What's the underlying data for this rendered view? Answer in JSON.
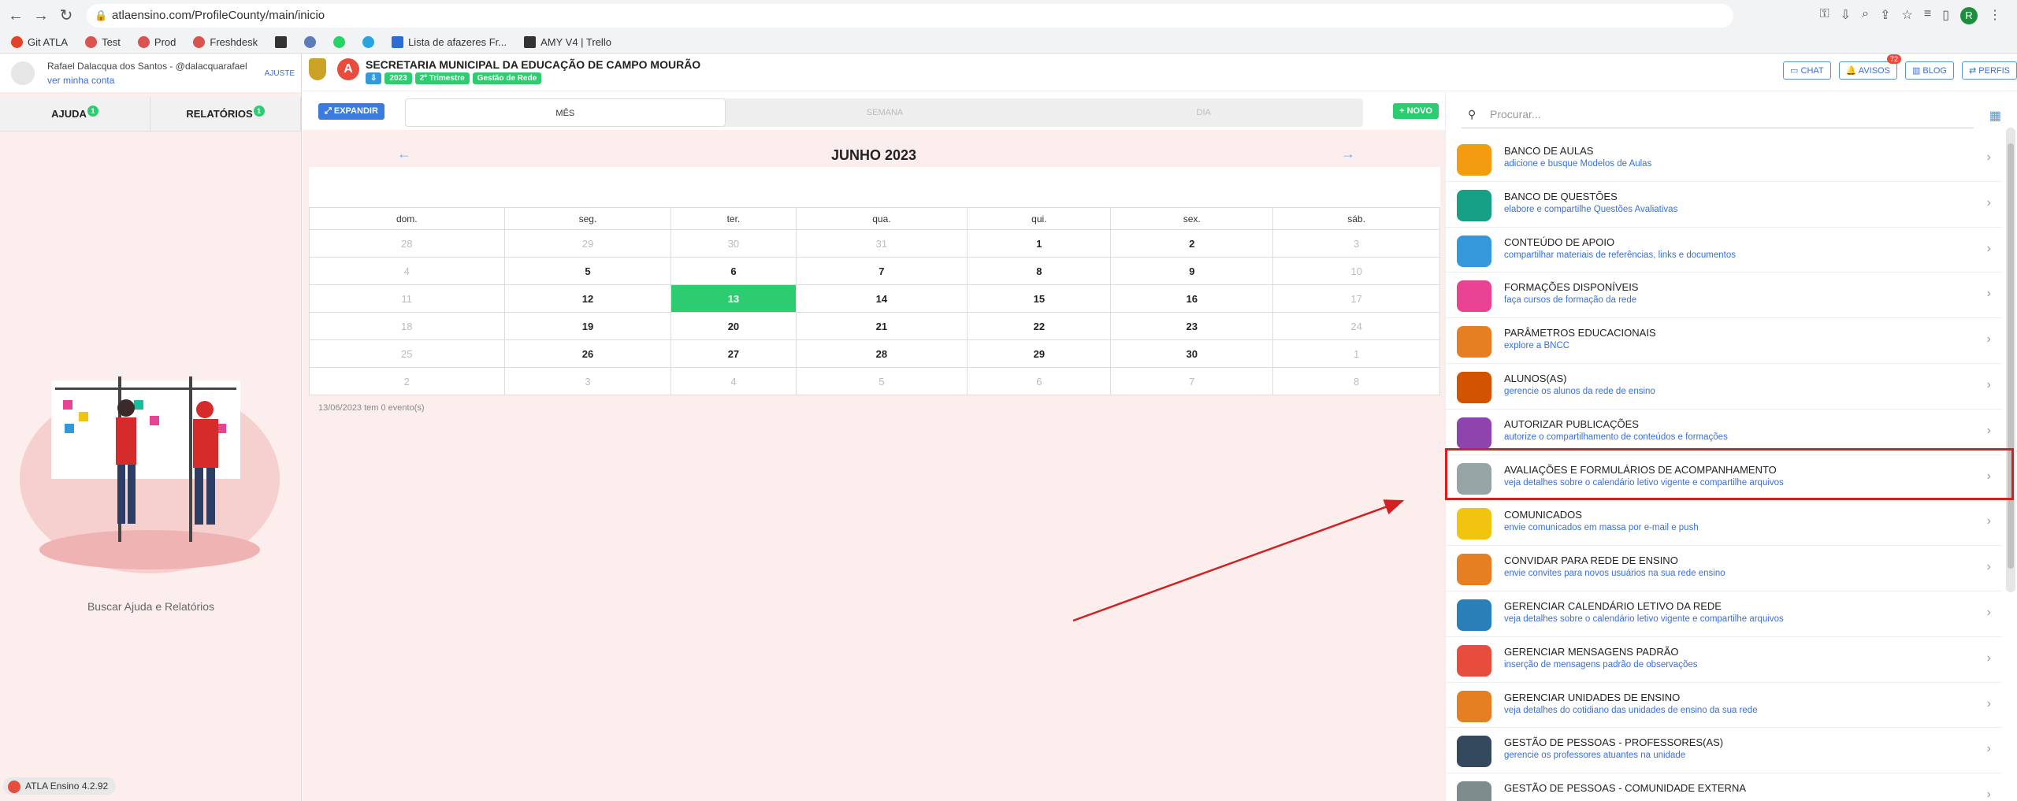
{
  "browser": {
    "url": "atlaensino.com/ProfileCounty/main/inicio",
    "bookmarks": [
      "Git ATLA",
      "Test",
      "Prod",
      "Freshdesk",
      "",
      "",
      "",
      "",
      "Lista de afazeres Fr...",
      "AMY V4 | Trello"
    ]
  },
  "sidebar": {
    "user_name": "Rafael Dalacqua dos Santos - @dalacquarafael",
    "account_link": "ver minha conta",
    "adjust": "AJUSTE",
    "tabs": [
      {
        "label": "AJUDA",
        "badge": "1"
      },
      {
        "label": "RELATÓRIOS",
        "badge": "1"
      }
    ],
    "help_text": "Buscar Ajuda e Relatórios",
    "version": "ATLA Ensino 4.2.92"
  },
  "header": {
    "title": "SECRETARIA MUNICIPAL DA EDUCAÇÃO DE CAMPO MOURÃO",
    "chips": [
      "2023",
      "2º Trimestre",
      "Gestão de Rede"
    ],
    "buttons": [
      {
        "label": "CHAT"
      },
      {
        "label": "AVISOS",
        "badge": "72"
      },
      {
        "label": "BLOG"
      },
      {
        "label": "PERFIS"
      }
    ]
  },
  "calendar": {
    "expand": "EXPANDIR",
    "views": [
      "MÊS",
      "SEMANA",
      "DIA"
    ],
    "new": "NOVO",
    "month_title": "JUNHO 2023",
    "weekdays": [
      "dom.",
      "seg.",
      "ter.",
      "qua.",
      "qui.",
      "sex.",
      "sáb."
    ],
    "weeks": [
      [
        "28",
        "29",
        "30",
        "31",
        "1",
        "2",
        "3"
      ],
      [
        "4",
        "5",
        "6",
        "7",
        "8",
        "9",
        "10"
      ],
      [
        "11",
        "12",
        "13",
        "14",
        "15",
        "16",
        "17"
      ],
      [
        "18",
        "19",
        "20",
        "21",
        "22",
        "23",
        "24"
      ],
      [
        "25",
        "26",
        "27",
        "28",
        "29",
        "30",
        "1"
      ],
      [
        "2",
        "3",
        "4",
        "5",
        "6",
        "7",
        "8"
      ]
    ],
    "events_text": "13/06/2023 tem 0 evento(s)"
  },
  "menu": {
    "search_placeholder": "Procurar...",
    "items": [
      {
        "title": "BANCO DE AULAS",
        "subtitle": "adicione e busque Modelos de Aulas",
        "color": "#f39c12"
      },
      {
        "title": "BANCO DE QUESTÕES",
        "subtitle": "elabore e compartilhe Questões Avaliativas",
        "color": "#16a085"
      },
      {
        "title": "CONTEÚDO DE APOIO",
        "subtitle": "compartilhar materiais de referências, links e documentos",
        "color": "#3498db"
      },
      {
        "title": "FORMAÇÕES DISPONÍVEIS",
        "subtitle": "faça cursos de formação da rede",
        "color": "#e84393"
      },
      {
        "title": "PARÂMETROS EDUCACIONAIS",
        "subtitle": "explore a BNCC",
        "color": "#e67e22"
      },
      {
        "title": "ALUNOS(AS)",
        "subtitle": "gerencie os alunos da rede de ensino",
        "color": "#d35400"
      },
      {
        "title": "AUTORIZAR PUBLICAÇÕES",
        "subtitle": "autorize o compartilhamento de conteúdos e formações",
        "color": "#8e44ad"
      },
      {
        "title": "AVALIAÇÕES E FORMULÁRIOS DE ACOMPANHAMENTO",
        "subtitle": "veja detalhes sobre o calendário letivo vigente e compartilhe arquivos",
        "color": "#95a5a6"
      },
      {
        "title": "COMUNICADOS",
        "subtitle": "envie comunicados em massa por e-mail e push",
        "color": "#f1c40f"
      },
      {
        "title": "CONVIDAR PARA REDE DE ENSINO",
        "subtitle": "envie convites para novos usuários na sua rede ensino",
        "color": "#e67e22"
      },
      {
        "title": "GERENCIAR CALENDÁRIO LETIVO DA REDE",
        "subtitle": "veja detalhes sobre o calendário letivo vigente e compartilhe arquivos",
        "color": "#2980b9"
      },
      {
        "title": "GERENCIAR MENSAGENS PADRÃO",
        "subtitle": "inserção de mensagens padrão de observações",
        "color": "#e74c3c"
      },
      {
        "title": "GERENCIAR UNIDADES DE ENSINO",
        "subtitle": "veja detalhes do cotidiano das unidades de ensino da sua rede",
        "color": "#e67e22"
      },
      {
        "title": "GESTÃO DE PESSOAS - PROFESSORES(AS)",
        "subtitle": "gerencie os professores atuantes na unidade",
        "color": "#34495e"
      },
      {
        "title": "GESTÃO DE PESSOAS - COMUNIDADE EXTERNA",
        "subtitle": "",
        "color": "#7f8c8d"
      }
    ]
  },
  "annotation": {
    "highlight_color": "#d42020"
  }
}
